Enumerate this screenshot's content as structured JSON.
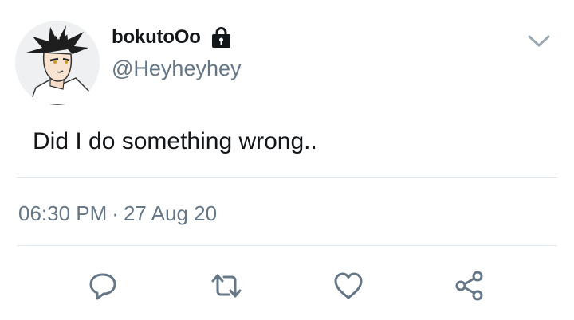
{
  "user": {
    "display_name": "bokutoOo",
    "handle": "@Heyheyhey",
    "avatar_icon": "avatar-image",
    "lock_icon": "lock-icon"
  },
  "tweet": {
    "text": "Did I do something wrong..",
    "time": "06:30 PM",
    "separator": "·",
    "date": "27 Aug 20"
  },
  "actions": [
    {
      "icon": "reply-icon"
    },
    {
      "icon": "retweet-icon"
    },
    {
      "icon": "like-icon"
    },
    {
      "icon": "share-icon"
    }
  ],
  "colors": {
    "text_primary": "#14171a",
    "text_secondary": "#657786",
    "divider": "#e1e8ed",
    "icon": "#657786"
  }
}
